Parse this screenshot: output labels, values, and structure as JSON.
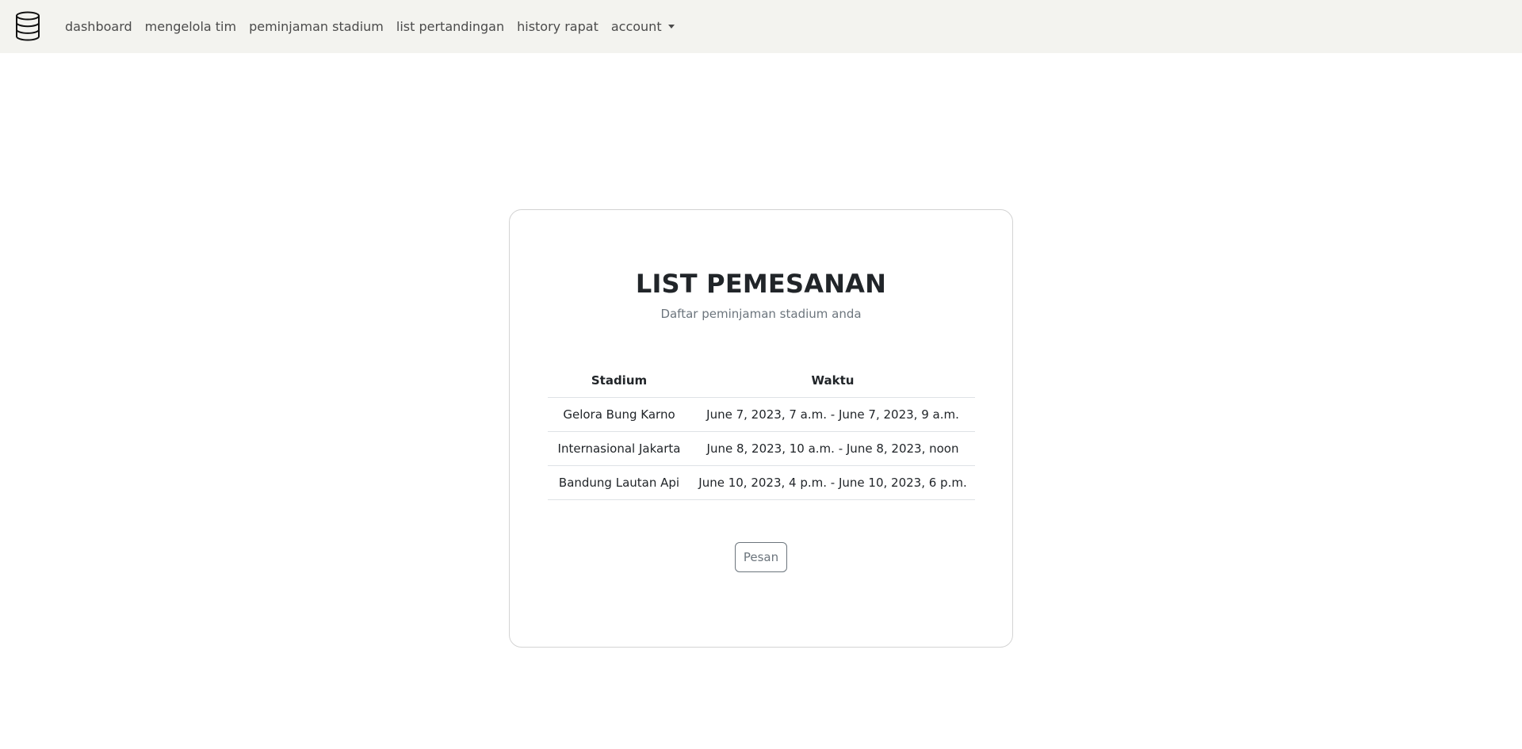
{
  "nav": {
    "brand_icon": "database-icon",
    "items": [
      {
        "label": "dashboard"
      },
      {
        "label": "mengelola tim"
      },
      {
        "label": "peminjaman stadium"
      },
      {
        "label": "list pertandingan"
      },
      {
        "label": "history rapat"
      },
      {
        "label": "account",
        "dropdown": true
      }
    ]
  },
  "card": {
    "title": "LIST PEMESANAN",
    "subtitle": "Daftar peminjaman stadium anda",
    "table": {
      "columns": [
        "Stadium",
        "Waktu"
      ],
      "rows": [
        [
          "Gelora Bung Karno",
          "June 7, 2023, 7 a.m. - June 7, 2023, 9 a.m."
        ],
        [
          "Internasional Jakarta",
          "June 8, 2023, 10 a.m. - June 8, 2023, noon"
        ],
        [
          "Bandung Lautan Api",
          "June 10, 2023, 4 p.m. - June 10, 2023, 6 p.m."
        ]
      ]
    },
    "button_label": "Pesan"
  },
  "colors": {
    "navbar_bg": "#f3f3ef",
    "text": "#212529",
    "muted": "#6c757d"
  }
}
